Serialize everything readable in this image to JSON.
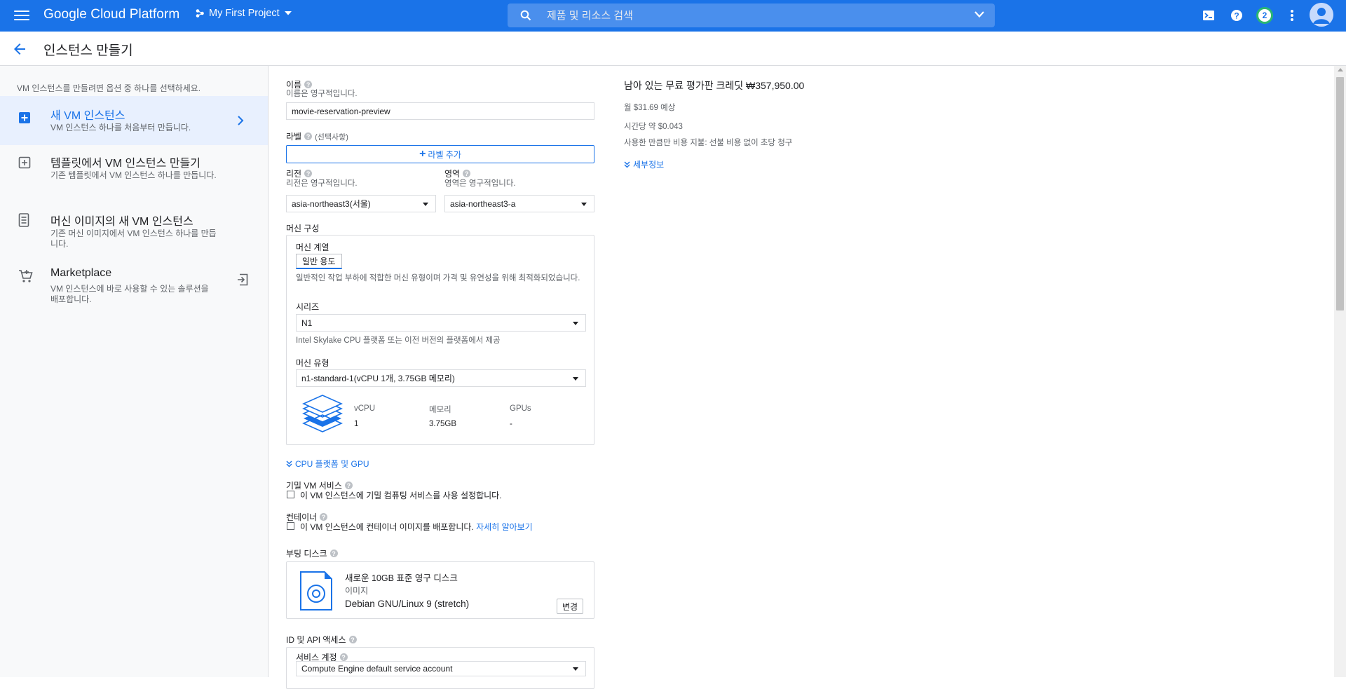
{
  "topbar": {
    "brand": "Google Cloud Platform",
    "project": "My First Project",
    "search_placeholder": "제품 및 리소스 검색",
    "notification_count": "2",
    "icons": [
      "menu-icon",
      "project-icon",
      "search-icon",
      "chevron-down-icon",
      "cloud-shell-icon",
      "help-icon",
      "more-vert-icon",
      "account-icon"
    ]
  },
  "titlebar": {
    "title": "인스턴스 만들기"
  },
  "left_panel": {
    "intro": "VM 인스턴스를 만들려면 옵션 중 하나를 선택하세요.",
    "options": [
      {
        "title": "새 VM 인스턴스",
        "desc": "VM 인스턴스 하나를 처음부터 만듭니다.",
        "icon": "add-box-icon",
        "active": true
      },
      {
        "title": "템플릿에서 VM 인스턴스 만들기",
        "desc": "기존 템플릿에서 VM 인스턴스 하나를 만듭니다.",
        "icon": "add-template-icon",
        "active": false
      },
      {
        "title": "머신 이미지의 새 VM 인스턴스",
        "desc": "기존 머신 이미지에서 VM 인스턴스 하나를 만듭니다.",
        "icon": "machine-image-icon",
        "active": false
      },
      {
        "title": "Marketplace",
        "desc": "VM 인스턴스에 바로 사용할 수 있는 솔루션을 배포합니다.",
        "icon": "cart-icon",
        "active": false
      }
    ]
  },
  "form": {
    "name": {
      "label": "이름",
      "sub": "이름은 영구적입니다.",
      "value": "movie-reservation-preview"
    },
    "labels": {
      "label": "라벨",
      "optional": "(선택사항)",
      "add_button": "라벨 추가"
    },
    "region": {
      "label": "리전",
      "sub": "리전은 영구적입니다.",
      "value": "asia-northeast3(서울)"
    },
    "zone": {
      "label": "영역",
      "sub": "영역은 영구적입니다.",
      "value": "asia-northeast3-a"
    },
    "machine_config": {
      "label": "머신 구성",
      "family_label": "머신 계열",
      "family_chip": "일반 용도",
      "family_desc": "일반적인 작업 부하에 적합한 머신 유형이며 가격 및 유연성을 위해 최적화되었습니다.",
      "series_label": "시리즈",
      "series_value": "N1",
      "series_desc": "Intel Skylake CPU 플랫폼 또는 이전 버전의 플랫폼에서 제공",
      "type_label": "머신 유형",
      "type_value": "n1-standard-1(vCPU 1개, 3.75GB 메모리)",
      "stats": {
        "vcpu_h": "vCPU",
        "vcpu_v": "1",
        "mem_h": "메모리",
        "mem_v": "3.75GB",
        "gpu_h": "GPUs",
        "gpu_v": "-"
      }
    },
    "cpu_gpu_link": "CPU 플랫폼 및 GPU",
    "confidential": {
      "label": "기밀 VM 서비스",
      "checkbox": "이 VM 인스턴스에 기밀 컴퓨팅 서비스를 사용 설정합니다."
    },
    "container": {
      "label": "컨테이너",
      "checkbox": "이 VM 인스턴스에 컨테이너 이미지를 배포합니다.",
      "learn_more": "자세히 알아보기"
    },
    "boot_disk": {
      "label": "부팅 디스크",
      "title": "새로운 10GB 표준 영구 디스크",
      "image_label": "이미지",
      "image": "Debian GNU/Linux 9 (stretch)",
      "change": "변경"
    },
    "identity": {
      "label": "ID 및 API 액세스",
      "service_account_label": "서비스 계정",
      "service_account": "Compute Engine default service account"
    }
  },
  "summary": {
    "title": "남아 있는 무료 평가판 크레딧 ₩357,950.00",
    "monthly": "월 $31.69 예상",
    "hourly": "시간당 약 $0.043",
    "billing_note": "사용한 만큼만 비용 지불: 선불 비용 없이 초당 청구",
    "details_link": "세부정보"
  },
  "colors": {
    "primary": "#1a73e8",
    "active_bg": "#e8f0fe",
    "panel_bg": "#f8f9fa",
    "border": "#dadce0"
  }
}
